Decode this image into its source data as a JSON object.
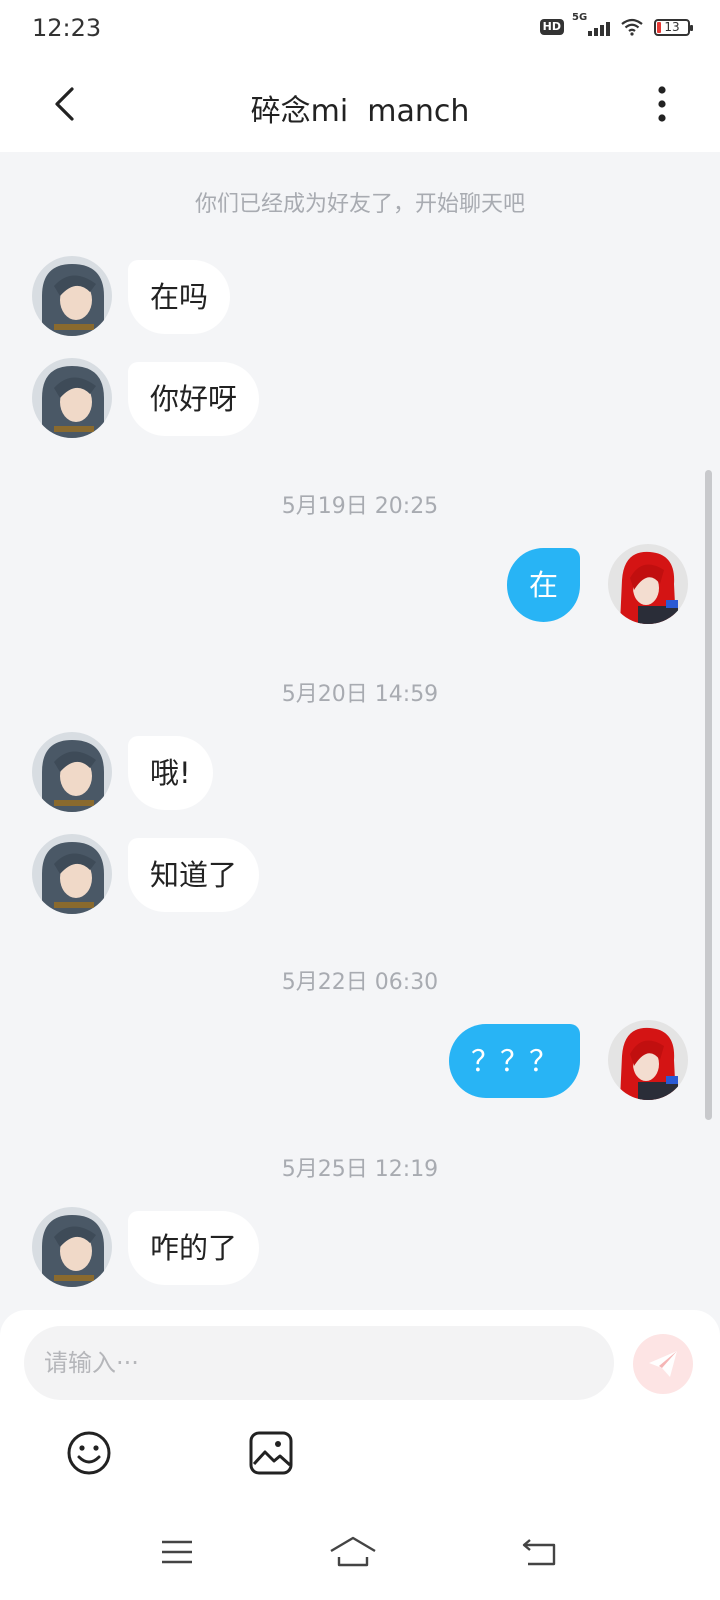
{
  "status_bar": {
    "time": "12:23",
    "network_badge": "HD",
    "network_type": "5G",
    "battery_level": "13",
    "battery_fraction": 0.13
  },
  "header": {
    "title": "碎念mi  manch"
  },
  "chat": {
    "system_note": "你们已经成为好友了，开始聊天吧",
    "timestamps": [
      "5月19日 20:25",
      "5月20日 14:59",
      "5月22日 06:30",
      "5月25日 12:19"
    ],
    "messages": [
      {
        "side": "left",
        "text": "在吗"
      },
      {
        "side": "left",
        "text": "你好呀"
      },
      {
        "side": "right",
        "text": "在"
      },
      {
        "side": "left",
        "text": "哦!"
      },
      {
        "side": "left",
        "text": "知道了"
      },
      {
        "side": "right",
        "text": "？？？"
      },
      {
        "side": "left",
        "text": "咋的了"
      }
    ]
  },
  "input": {
    "placeholder": "请输入···",
    "value": ""
  },
  "colors": {
    "accent_bubble": "#28b4f5",
    "send_button_bg": "#fde4e4",
    "send_icon": "#f5b5b5",
    "battery_low": "#e53935"
  },
  "icons": {
    "back": "chevron-left-icon",
    "more": "more-vertical-icon",
    "send": "paper-plane-icon",
    "emoji": "smiley-icon",
    "image": "image-icon",
    "nav_menu": "menu-icon",
    "nav_home": "home-icon",
    "nav_back": "back-icon"
  }
}
